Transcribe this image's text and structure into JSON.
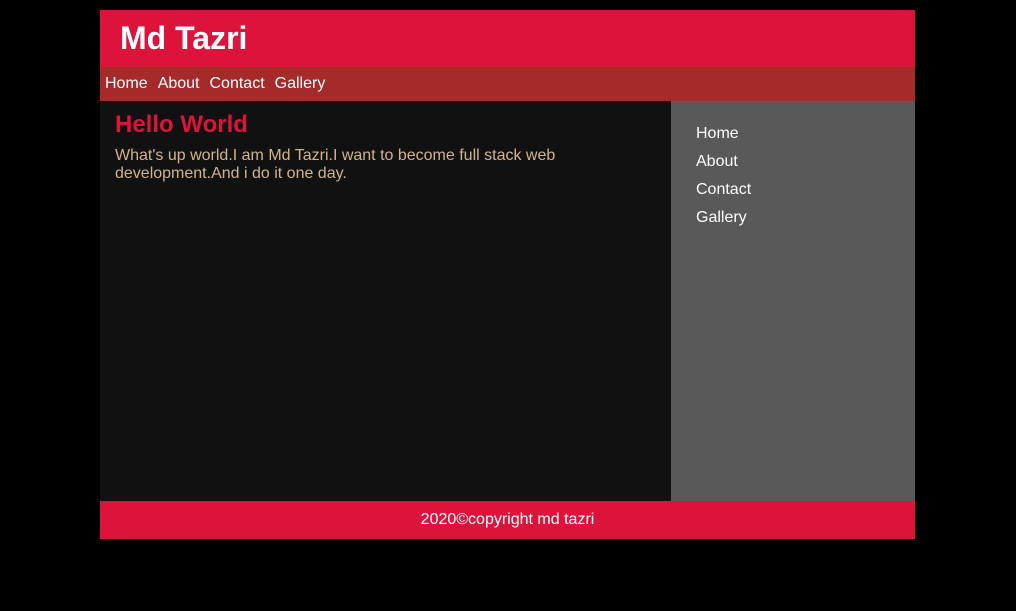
{
  "header": {
    "title": "Md Tazri"
  },
  "topnav": {
    "items": [
      {
        "label": "Home"
      },
      {
        "label": "About"
      },
      {
        "label": "Contact"
      },
      {
        "label": "Gallery"
      }
    ]
  },
  "main": {
    "heading": "Hello World",
    "paragraph": "What's up world.I am Md Tazri.I want to become full stack web development.And i do it one day."
  },
  "sidebar": {
    "items": [
      {
        "label": "Home"
      },
      {
        "label": "About"
      },
      {
        "label": "Contact"
      },
      {
        "label": "Gallery"
      }
    ]
  },
  "footer": {
    "text": "2020©copyright md tazri"
  },
  "colors": {
    "page_background": "#000000",
    "header_background": "#dc143c",
    "nav_background": "#a52a2a",
    "main_background": "#111111",
    "sidebar_background": "#595959",
    "heading_color": "#dc143c",
    "paragraph_color": "#d2b48c"
  }
}
